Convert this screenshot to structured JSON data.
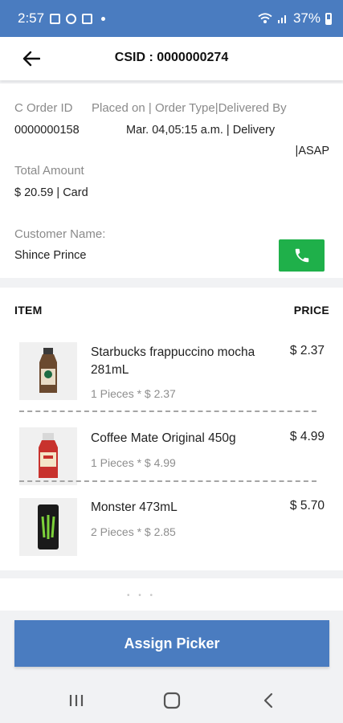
{
  "status_bar": {
    "time": "2:57",
    "battery": "37%"
  },
  "header": {
    "title": "CSID : 0000000274"
  },
  "order": {
    "id_label": "C Order ID",
    "meta_label": "Placed on | Order Type|Delivered By",
    "id_value": "0000000158",
    "meta_value": "Mar. 04,05:15 a.m. | Delivery",
    "meta_value_2": "|ASAP",
    "total_label": "Total Amount",
    "total_value": "$ 20.59 | Card",
    "customer_label": "Customer Name:",
    "customer_value": "Shince Prince"
  },
  "items_table": {
    "col_item": "ITEM",
    "col_price": "PRICE",
    "rows": [
      {
        "name": "Starbucks frappuccino mocha 281mL",
        "qty": "1 Pieces * $ 2.37",
        "price": "$ 2.37"
      },
      {
        "name": "Coffee Mate Original 450g",
        "qty": "1 Pieces * $ 4.99",
        "price": "$ 4.99"
      },
      {
        "name": "Monster 473mL",
        "qty": "2 Pieces * $ 2.85",
        "price": "$ 5.70"
      }
    ]
  },
  "actions": {
    "assign_label": "Assign Picker"
  },
  "icons": {
    "back": "arrow-left-icon",
    "phone": "phone-icon",
    "nav_recent": "recent-apps-icon",
    "nav_home": "home-icon",
    "nav_back": "back-chevron-icon"
  },
  "colors": {
    "primary": "#4a7cc0",
    "call": "#1fb04a"
  }
}
